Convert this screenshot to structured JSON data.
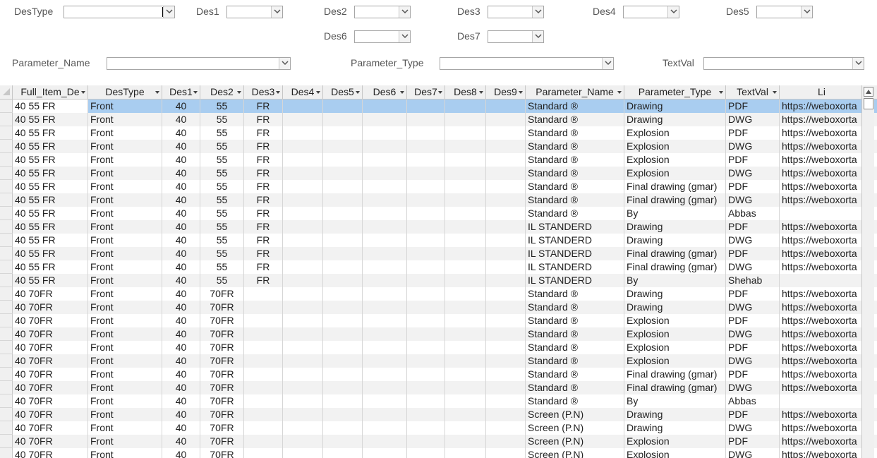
{
  "filters": {
    "destype": {
      "label": "DesType",
      "value": ""
    },
    "des1": {
      "label": "Des1",
      "value": ""
    },
    "des2": {
      "label": "Des2",
      "value": ""
    },
    "des3": {
      "label": "Des3",
      "value": ""
    },
    "des4": {
      "label": "Des4",
      "value": ""
    },
    "des5": {
      "label": "Des5",
      "value": ""
    },
    "des6": {
      "label": "Des6",
      "value": ""
    },
    "des7": {
      "label": "Des7",
      "value": ""
    },
    "parameter_name": {
      "label": "Parameter_Name",
      "value": ""
    },
    "parameter_type": {
      "label": "Parameter_Type",
      "value": ""
    },
    "textval": {
      "label": "TextVal",
      "value": ""
    }
  },
  "columns": [
    "Full_Item_De",
    "DesType",
    "Des1",
    "Des2",
    "Des3",
    "Des4",
    "Des5",
    "Des6",
    "Des7",
    "Des8",
    "Des9",
    "Parameter_Name",
    "Parameter_Type",
    "TextVal",
    "Li"
  ],
  "rows": [
    [
      "40 55 FR",
      "Front",
      "40",
      "55",
      "FR",
      "",
      "",
      "",
      "",
      "",
      "",
      "Standard ®",
      "Drawing",
      "PDF",
      "https://weboxorta"
    ],
    [
      "40 55 FR",
      "Front",
      "40",
      "55",
      "FR",
      "",
      "",
      "",
      "",
      "",
      "",
      "Standard ®",
      "Drawing",
      "DWG",
      "https://weboxorta"
    ],
    [
      "40 55 FR",
      "Front",
      "40",
      "55",
      "FR",
      "",
      "",
      "",
      "",
      "",
      "",
      "Standard ®",
      "Explosion",
      "PDF",
      "https://weboxorta"
    ],
    [
      "40 55 FR",
      "Front",
      "40",
      "55",
      "FR",
      "",
      "",
      "",
      "",
      "",
      "",
      "Standard ®",
      "Explosion",
      "DWG",
      "https://weboxorta"
    ],
    [
      "40 55 FR",
      "Front",
      "40",
      "55",
      "FR",
      "",
      "",
      "",
      "",
      "",
      "",
      "Standard ®",
      "Explosion",
      "PDF",
      "https://weboxorta"
    ],
    [
      "40 55 FR",
      "Front",
      "40",
      "55",
      "FR",
      "",
      "",
      "",
      "",
      "",
      "",
      "Standard ®",
      "Explosion",
      "DWG",
      "https://weboxorta"
    ],
    [
      "40 55 FR",
      "Front",
      "40",
      "55",
      "FR",
      "",
      "",
      "",
      "",
      "",
      "",
      "Standard ®",
      "Final drawing (gmar)",
      "PDF",
      "https://weboxorta"
    ],
    [
      "40 55 FR",
      "Front",
      "40",
      "55",
      "FR",
      "",
      "",
      "",
      "",
      "",
      "",
      "Standard ®",
      "Final drawing (gmar)",
      "DWG",
      "https://weboxorta"
    ],
    [
      "40 55 FR",
      "Front",
      "40",
      "55",
      "FR",
      "",
      "",
      "",
      "",
      "",
      "",
      "Standard ®",
      "By",
      "Abbas",
      ""
    ],
    [
      "40 55 FR",
      "Front",
      "40",
      "55",
      "FR",
      "",
      "",
      "",
      "",
      "",
      "",
      "IL STANDERD",
      "Drawing",
      "PDF",
      "https://weboxorta"
    ],
    [
      "40 55 FR",
      "Front",
      "40",
      "55",
      "FR",
      "",
      "",
      "",
      "",
      "",
      "",
      "IL STANDERD",
      "Drawing",
      "DWG",
      "https://weboxorta"
    ],
    [
      "40 55 FR",
      "Front",
      "40",
      "55",
      "FR",
      "",
      "",
      "",
      "",
      "",
      "",
      "IL STANDERD",
      "Final drawing (gmar)",
      "PDF",
      "https://weboxorta"
    ],
    [
      "40 55 FR",
      "Front",
      "40",
      "55",
      "FR",
      "",
      "",
      "",
      "",
      "",
      "",
      "IL STANDERD",
      "Final drawing (gmar)",
      "DWG",
      "https://weboxorta"
    ],
    [
      "40 55 FR",
      "Front",
      "40",
      "55",
      "FR",
      "",
      "",
      "",
      "",
      "",
      "",
      "IL STANDERD",
      "By",
      "Shehab",
      ""
    ],
    [
      "40 70FR",
      "Front",
      "40",
      "70FR",
      "",
      "",
      "",
      "",
      "",
      "",
      "",
      "Standard ®",
      "Drawing",
      "PDF",
      "https://weboxorta"
    ],
    [
      "40 70FR",
      "Front",
      "40",
      "70FR",
      "",
      "",
      "",
      "",
      "",
      "",
      "",
      "Standard ®",
      "Drawing",
      "DWG",
      "https://weboxorta"
    ],
    [
      "40 70FR",
      "Front",
      "40",
      "70FR",
      "",
      "",
      "",
      "",
      "",
      "",
      "",
      "Standard ®",
      "Explosion",
      "PDF",
      "https://weboxorta"
    ],
    [
      "40 70FR",
      "Front",
      "40",
      "70FR",
      "",
      "",
      "",
      "",
      "",
      "",
      "",
      "Standard ®",
      "Explosion",
      "DWG",
      "https://weboxorta"
    ],
    [
      "40 70FR",
      "Front",
      "40",
      "70FR",
      "",
      "",
      "",
      "",
      "",
      "",
      "",
      "Standard ®",
      "Explosion",
      "PDF",
      "https://weboxorta"
    ],
    [
      "40 70FR",
      "Front",
      "40",
      "70FR",
      "",
      "",
      "",
      "",
      "",
      "",
      "",
      "Standard ®",
      "Explosion",
      "DWG",
      "https://weboxorta"
    ],
    [
      "40 70FR",
      "Front",
      "40",
      "70FR",
      "",
      "",
      "",
      "",
      "",
      "",
      "",
      "Standard ®",
      "Final drawing (gmar)",
      "PDF",
      "https://weboxorta"
    ],
    [
      "40 70FR",
      "Front",
      "40",
      "70FR",
      "",
      "",
      "",
      "",
      "",
      "",
      "",
      "Standard ®",
      "Final drawing (gmar)",
      "DWG",
      "https://weboxorta"
    ],
    [
      "40 70FR",
      "Front",
      "40",
      "70FR",
      "",
      "",
      "",
      "",
      "",
      "",
      "",
      "Standard ®",
      "By",
      "Abbas",
      ""
    ],
    [
      "40 70FR",
      "Front",
      "40",
      "70FR",
      "",
      "",
      "",
      "",
      "",
      "",
      "",
      "Screen (P.N)",
      "Drawing",
      "PDF",
      "https://weboxorta"
    ],
    [
      "40 70FR",
      "Front",
      "40",
      "70FR",
      "",
      "",
      "",
      "",
      "",
      "",
      "",
      "Screen (P.N)",
      "Drawing",
      "DWG",
      "https://weboxorta"
    ],
    [
      "40 70FR",
      "Front",
      "40",
      "70FR",
      "",
      "",
      "",
      "",
      "",
      "",
      "",
      "Screen (P.N)",
      "Explosion",
      "PDF",
      "https://weboxorta"
    ],
    [
      "40 70FR",
      "Front",
      "40",
      "70FR",
      "",
      "",
      "",
      "",
      "",
      "",
      "",
      "Screen (P.N)",
      "Explosion",
      "DWG",
      "https://weboxorta"
    ]
  ],
  "colors": {
    "selected_row": "#a9cdf0",
    "alt_row": "#f2f2f2",
    "header": "#f0f0f0"
  },
  "selected_row_index": 0,
  "icons": {
    "dropdown": "chevron-down-icon",
    "corner": "select-all-icon",
    "scroll_up": "arrow-up-icon"
  }
}
